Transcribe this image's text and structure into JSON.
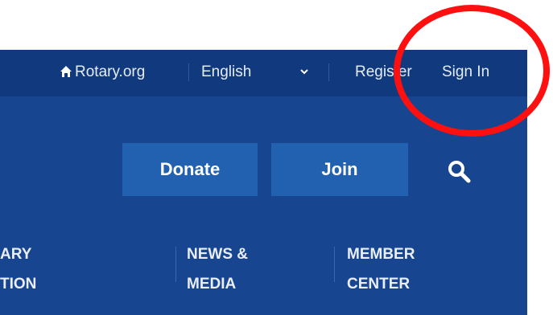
{
  "utility_bar": {
    "home_link": "Rotary.org",
    "language": "English",
    "register": "Register",
    "sign_in": "Sign In"
  },
  "actions": {
    "donate": "Donate",
    "join": "Join"
  },
  "main_nav": [
    {
      "line1": "ARY",
      "line2": "TION"
    },
    {
      "line1": "NEWS &",
      "line2": "MEDIA"
    },
    {
      "line1": "MEMBER",
      "line2": "CENTER"
    }
  ],
  "icons": [
    "home-icon",
    "chevron-down-icon",
    "search-icon"
  ],
  "colors": {
    "brand_blue": "#17458f",
    "utility_bar": "#103a7d",
    "button": "#2260b0",
    "annotation": "#ff1010"
  }
}
